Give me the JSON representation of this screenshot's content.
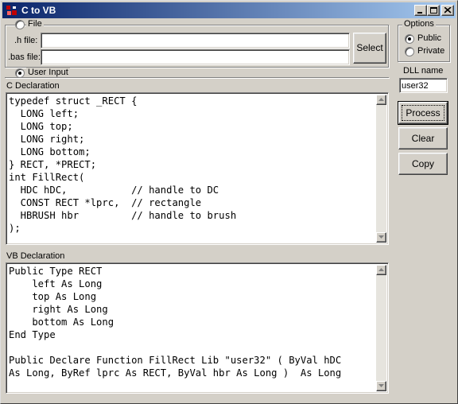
{
  "window": {
    "title": "C to VB"
  },
  "file_group": {
    "label": "File",
    "h_file_label": ".h file:",
    "h_file_value": "",
    "bas_file_label": ".bas file:",
    "bas_file_value": "",
    "select_button": "Select",
    "selected": false
  },
  "user_input": {
    "label": "User Input",
    "selected": true
  },
  "c_declaration": {
    "label": "C Declaration",
    "code": "typedef struct _RECT {\n  LONG left;\n  LONG top;\n  LONG right;\n  LONG bottom;\n} RECT, *PRECT;\nint FillRect(\n  HDC hDC,           // handle to DC\n  CONST RECT *lprc,  // rectangle\n  HBRUSH hbr         // handle to brush\n);"
  },
  "vb_declaration": {
    "label": "VB Declaration",
    "code": "Public Type RECT\n    left As Long\n    top As Long\n    right As Long\n    bottom As Long\nEnd Type\n\nPublic Declare Function FillRect Lib \"user32\" ( ByVal hDC\nAs Long, ByRef lprc As RECT, ByVal hbr As Long )  As Long"
  },
  "options": {
    "label": "Options",
    "public_label": "Public",
    "private_label": "Private",
    "selected": "Public",
    "dll_name_label": "DLL name",
    "dll_name_value": "user32"
  },
  "buttons": {
    "process": "Process",
    "clear": "Clear",
    "copy": "Copy"
  }
}
